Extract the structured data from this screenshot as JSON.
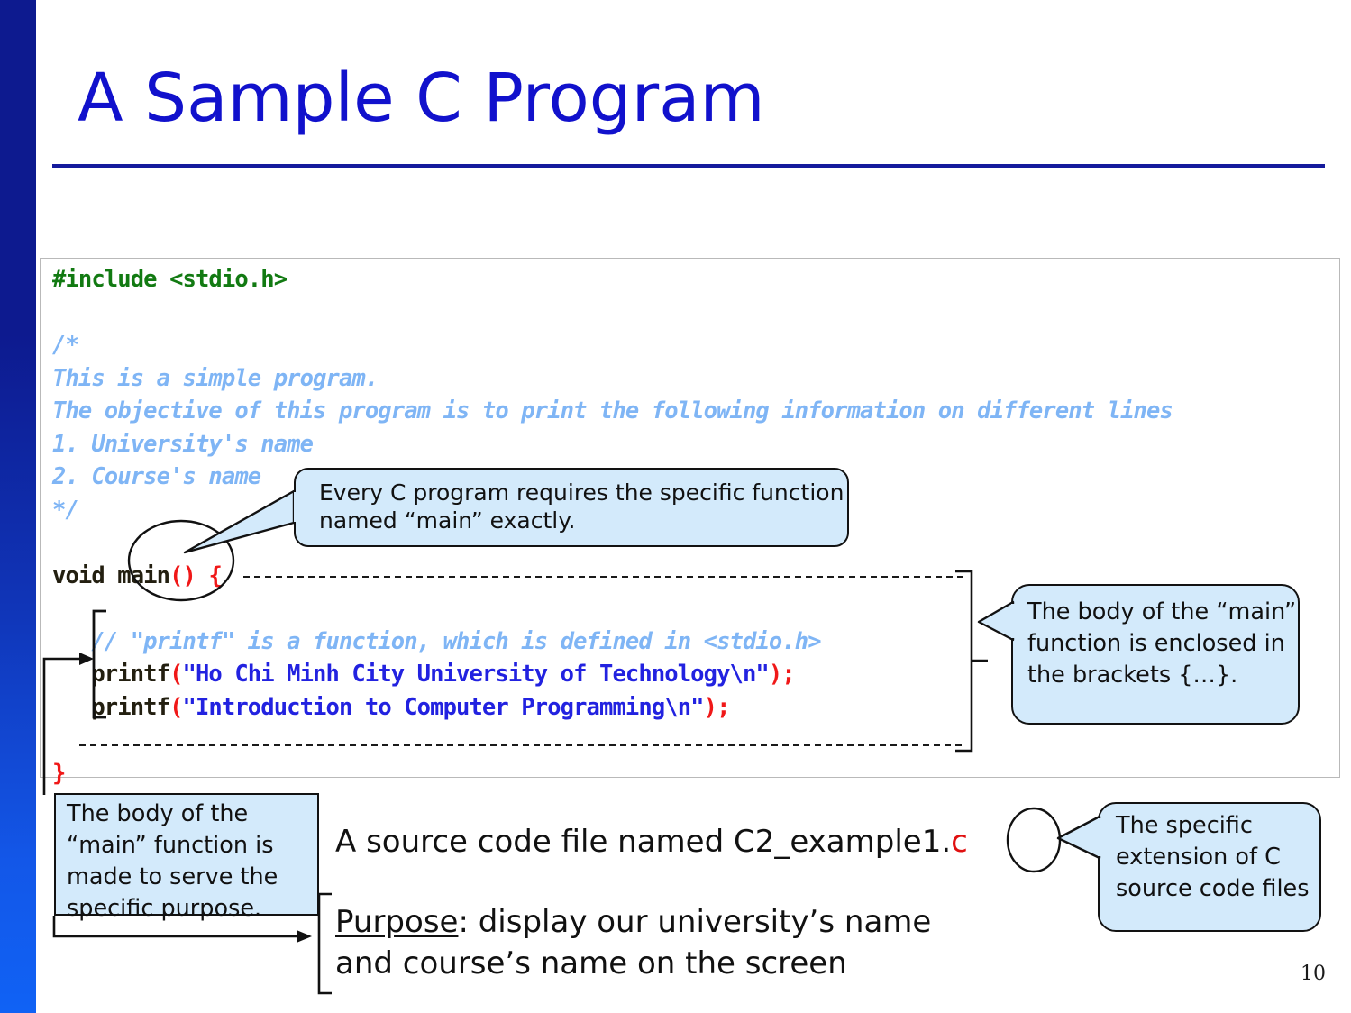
{
  "slide": {
    "title": "A Sample C Program",
    "page_number": "10",
    "accent_title_color": "#1111cc",
    "rule_color": "#151a9c",
    "sidebar_top_color": "#0d1a8f",
    "sidebar_bottom_color": "#1062f5",
    "callout_fill": "#d3eafb",
    "callout_border": "#121212"
  },
  "code": {
    "lines": [
      {
        "segments": [
          {
            "text": "#include <stdio.h>",
            "style": "green"
          }
        ]
      },
      {
        "segments": [
          {
            "text": "",
            "style": "dark"
          }
        ]
      },
      {
        "segments": [
          {
            "text": "/*",
            "style": "comment"
          }
        ]
      },
      {
        "segments": [
          {
            "text": "This is a simple program.",
            "style": "comment"
          }
        ]
      },
      {
        "segments": [
          {
            "text": "The objective of this program is to print the following information on different lines",
            "style": "comment"
          }
        ]
      },
      {
        "segments": [
          {
            "text": "1. University's name",
            "style": "comment"
          }
        ]
      },
      {
        "segments": [
          {
            "text": "2. Course's name",
            "style": "comment"
          }
        ]
      },
      {
        "segments": [
          {
            "text": "*/",
            "style": "comment"
          }
        ]
      },
      {
        "segments": [
          {
            "text": "",
            "style": "dark"
          }
        ]
      },
      {
        "segments": [
          {
            "text": "void main",
            "style": "dark"
          },
          {
            "text": "()",
            "style": "red"
          },
          {
            "text": " ",
            "style": "dark"
          },
          {
            "text": "{",
            "style": "red"
          }
        ]
      },
      {
        "segments": [
          {
            "text": "",
            "style": "dark"
          }
        ]
      },
      {
        "segments": [
          {
            "text": "   ",
            "style": "dark"
          },
          {
            "text": "// \"printf\" is a function, which is defined in <stdio.h>",
            "style": "comment"
          }
        ]
      },
      {
        "segments": [
          {
            "text": "   printf",
            "style": "dark"
          },
          {
            "text": "(",
            "style": "red"
          },
          {
            "text": "\"Ho Chi Minh City University of Technology\\n\"",
            "style": "str"
          },
          {
            "text": ");",
            "style": "red"
          }
        ]
      },
      {
        "segments": [
          {
            "text": "   printf",
            "style": "dark"
          },
          {
            "text": "(",
            "style": "red"
          },
          {
            "text": "\"Introduction to Computer Programming\\n\"",
            "style": "str"
          },
          {
            "text": ");",
            "style": "red"
          }
        ]
      },
      {
        "segments": [
          {
            "text": "",
            "style": "dark"
          }
        ]
      },
      {
        "segments": [
          {
            "text": "}",
            "style": "red"
          }
        ]
      }
    ]
  },
  "annotations": {
    "main_function": "Every C program requires the specific function named “main” exactly.",
    "body_brackets": "The body of the “main” function is enclosed in the brackets {…}.",
    "body_purpose": "The body of the “main” function is made to serve the specific purpose.",
    "c_extension": "The specific extension of C source code files"
  },
  "bottom": {
    "source_file_prefix": "A source code file named C2_example1",
    "source_file_dot": ".",
    "source_file_ext": "c",
    "purpose_label": "Purpose",
    "purpose_rest": ": display our university’s name",
    "purpose_line2": "and course’s name on the screen"
  }
}
